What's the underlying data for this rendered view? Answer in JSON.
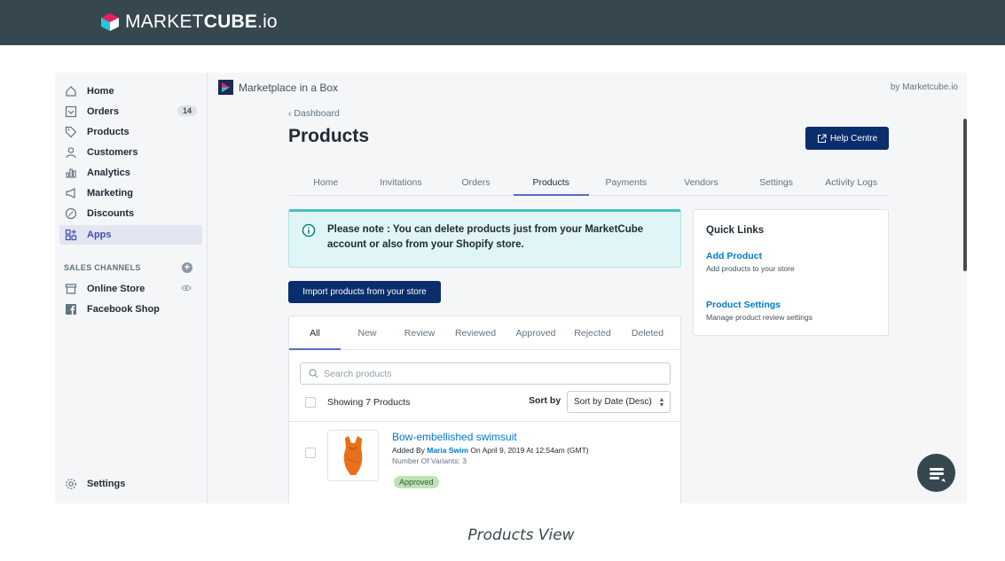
{
  "site": {
    "brand_light": "MARKET",
    "brand_bold": "CUBE",
    "brand_suffix": ".io",
    "caption": "Products View"
  },
  "sidebar": {
    "items": [
      {
        "label": "Home",
        "icon": "home-icon"
      },
      {
        "label": "Orders",
        "icon": "orders-icon",
        "badge": "14"
      },
      {
        "label": "Products",
        "icon": "tag-icon"
      },
      {
        "label": "Customers",
        "icon": "person-icon"
      },
      {
        "label": "Analytics",
        "icon": "bar-chart-icon"
      },
      {
        "label": "Marketing",
        "icon": "megaphone-icon"
      },
      {
        "label": "Discounts",
        "icon": "discount-icon"
      },
      {
        "label": "Apps",
        "icon": "apps-icon",
        "active": true
      }
    ],
    "channels_title": "SALES CHANNELS",
    "channels": [
      {
        "label": "Online Store",
        "icon": "store-icon"
      },
      {
        "label": "Facebook Shop",
        "icon": "facebook-icon"
      }
    ],
    "settings_label": "Settings"
  },
  "app": {
    "name": "Marketplace in a Box",
    "by": "by Marketcube.io",
    "breadcrumb": "Dashboard",
    "title": "Products",
    "help_label": "Help Centre",
    "tabs": [
      "Home",
      "Invitations",
      "Orders",
      "Products",
      "Payments",
      "Vendors",
      "Settings",
      "Activity Logs"
    ],
    "active_tab": "Products",
    "notice": "Please note : You can delete products just from your MarketCube account or also from your Shopify store.",
    "import_label": "Import products from your store"
  },
  "products": {
    "tabs": [
      "All",
      "New",
      "Review",
      "Reviewed",
      "Approved",
      "Rejected",
      "Deleted"
    ],
    "active_tab": "All",
    "search_placeholder": "Search products",
    "showing": "Showing 7 Products",
    "sort_label": "Sort by",
    "sort_value": "Sort by Date (Desc)",
    "items": [
      {
        "name": "Bow-embellished swimsuit",
        "added_prefix": "Added By",
        "seller": "Maria Swim",
        "added_suffix": "On April 9, 2019 At 12:54am (GMT)",
        "variants": "Number Of Variants: 3",
        "status": "Approved"
      }
    ]
  },
  "quick_links": {
    "title": "Quick Links",
    "links": [
      {
        "label": "Add Product",
        "desc": "Add products to your store"
      },
      {
        "label": "Product Settings",
        "desc": "Manage product review settings"
      }
    ]
  },
  "colors": {
    "topbar": "#37474f",
    "primary_button": "#0a2d6b",
    "link": "#007ace",
    "active_indicator": "#5c6ac4",
    "notice_bg": "#e0f5f5",
    "approved_badge": "#bbe5b3"
  }
}
